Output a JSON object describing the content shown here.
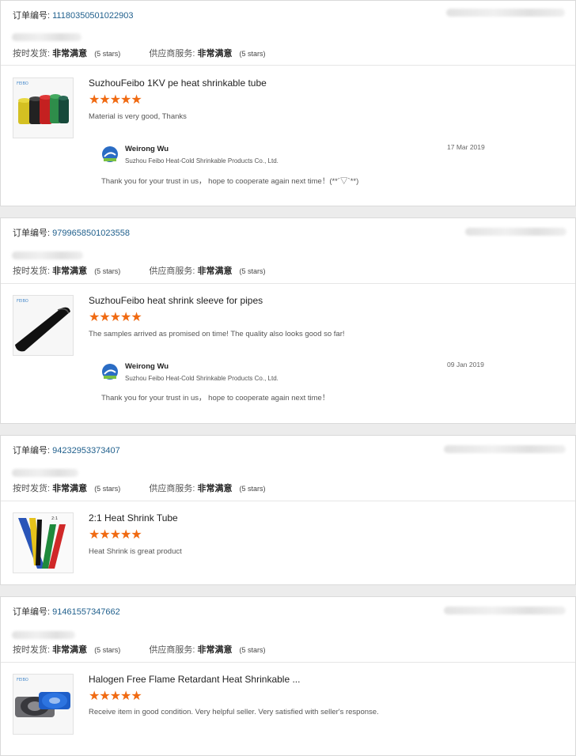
{
  "labels": {
    "order_no": "订单编号:",
    "shipping": "按时发货:",
    "supplier_service": "供应商服务:",
    "very_satisfied": "非常满意",
    "stars_note": "(5 stars)"
  },
  "orders": [
    {
      "order_number": "11180350501022903",
      "product_title": "SuzhouFeibo 1KV pe heat shrinkable tube",
      "rating": 5,
      "review": "Material is very good, Thanks",
      "reply": {
        "name": "Weirong Wu",
        "company": "Suzhou Feibo Heat-Cold Shrinkable Products Co., Ltd.",
        "date": "17 Mar 2019",
        "text": "Thank you for your trust in us， hope to cooperate again next time！(**´▽`**)"
      }
    },
    {
      "order_number": "9799658501023558",
      "product_title": "SuzhouFeibo heat shrink sleeve for pipes",
      "rating": 5,
      "review": "The samples arrived as promised on time! The quality also looks good so far!",
      "reply": {
        "name": "Weirong Wu",
        "company": "Suzhou Feibo Heat-Cold Shrinkable Products Co., Ltd.",
        "date": "09 Jan 2019",
        "text": "Thank you for your trust in us， hope to cooperate again next time！"
      }
    },
    {
      "order_number": "94232953373407",
      "product_title": "2:1 Heat Shrink Tube",
      "rating": 5,
      "review": "Heat Shrink is great product"
    },
    {
      "order_number": "91461557347662",
      "product_title": "Halogen Free Flame Retardant Heat Shrinkable ...",
      "rating": 5,
      "review": "Receive item in good condition. Very helpful seller. Very satisfied with seller's response."
    }
  ],
  "star_glyph": "★★★★★",
  "colors": {
    "star": "#f06a12",
    "order_number": "#1f5f8c"
  },
  "icons": {
    "seller_avatar": "feibo-logo-icon",
    "product_image": "product-thumbnail"
  }
}
